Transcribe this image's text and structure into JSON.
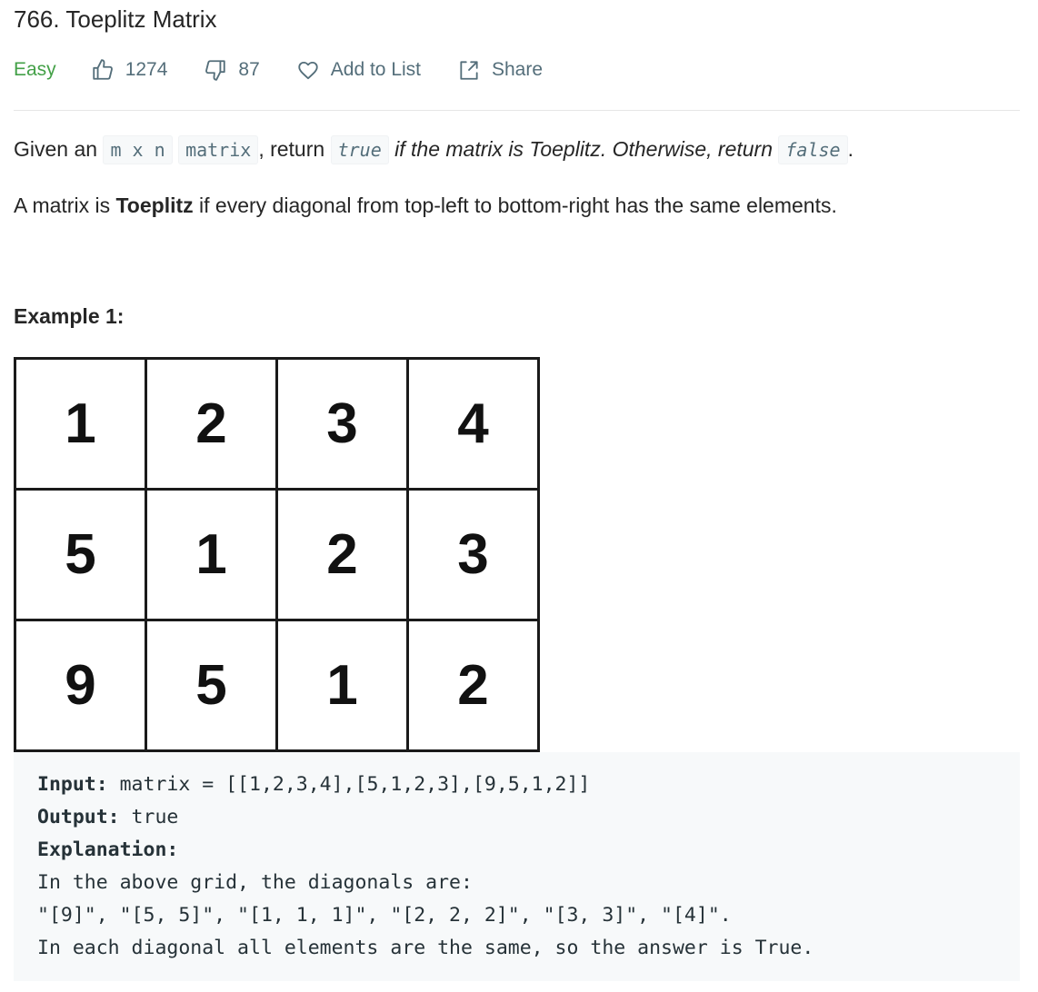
{
  "problem": {
    "title": "766. Toeplitz Matrix",
    "difficulty": "Easy",
    "likes": "1274",
    "dislikes": "87",
    "add_to_list_label": "Add to List",
    "share_label": "Share"
  },
  "description": {
    "p1_given": "Given an ",
    "p1_code_mxn": "m x n",
    "p1_code_matrix": "matrix",
    "p1_return": ", return ",
    "p1_code_true": "true",
    "p1_if": " if the matrix is Toeplitz. Otherwise, return ",
    "p1_code_false": "false",
    "p1_end": ".",
    "p2_pre": "A matrix is ",
    "p2_bold": "Toeplitz",
    "p2_post": " if every diagonal from top-left to bottom-right has the same elements."
  },
  "example1": {
    "title": "Example 1:",
    "grid": [
      [
        "1",
        "2",
        "3",
        "4"
      ],
      [
        "5",
        "1",
        "2",
        "3"
      ],
      [
        "9",
        "5",
        "1",
        "2"
      ]
    ],
    "input_label": "Input:",
    "input_value": " matrix = [[1,2,3,4],[5,1,2,3],[9,5,1,2]]",
    "output_label": "Output:",
    "output_value": " true",
    "explanation_label": "Explanation:",
    "explanation_line1": "In the above grid, the diagonals are:",
    "explanation_line2": "\"[9]\", \"[5, 5]\", \"[1, 1, 1]\", \"[2, 2, 2]\", \"[3, 3]\", \"[4]\".",
    "explanation_line3": "In each diagonal all elements are the same, so the answer is True."
  },
  "icons": {
    "like": "thumbs-up-icon",
    "dislike": "thumbs-down-icon",
    "add_to_list": "heart-icon",
    "share": "share-icon"
  },
  "colors": {
    "difficulty_easy": "#43a047",
    "meta_text": "#546e7a",
    "code_bg": "#f7f9fa"
  }
}
